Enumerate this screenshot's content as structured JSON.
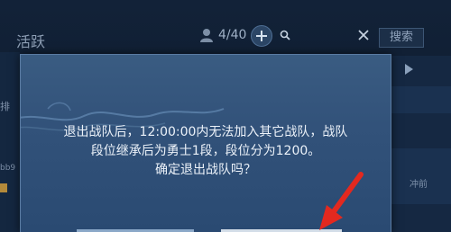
{
  "background": {
    "title": "活跃",
    "member_count": "4/40",
    "search_button": "搜索",
    "left_label_1": "排",
    "left_label_2": "bb9",
    "right_label": "冲前"
  },
  "dialog": {
    "message_lines": [
      "退出战队后，12:00:00内无法加入其它战队，战队",
      "段位继承后为勇士1段，段位分为1200。",
      "确定退出战队吗？"
    ]
  },
  "colors": {
    "dialog_bg": "#32527a",
    "dialog_text": "#ecf2f9",
    "arrow": "#e3291f"
  },
  "icons": {
    "member": "team-member-icon",
    "add": "plus-icon",
    "search": "search-icon",
    "clear": "close-icon",
    "arrow": "chevron-right-icon",
    "pointer": "red-arrow-icon"
  }
}
